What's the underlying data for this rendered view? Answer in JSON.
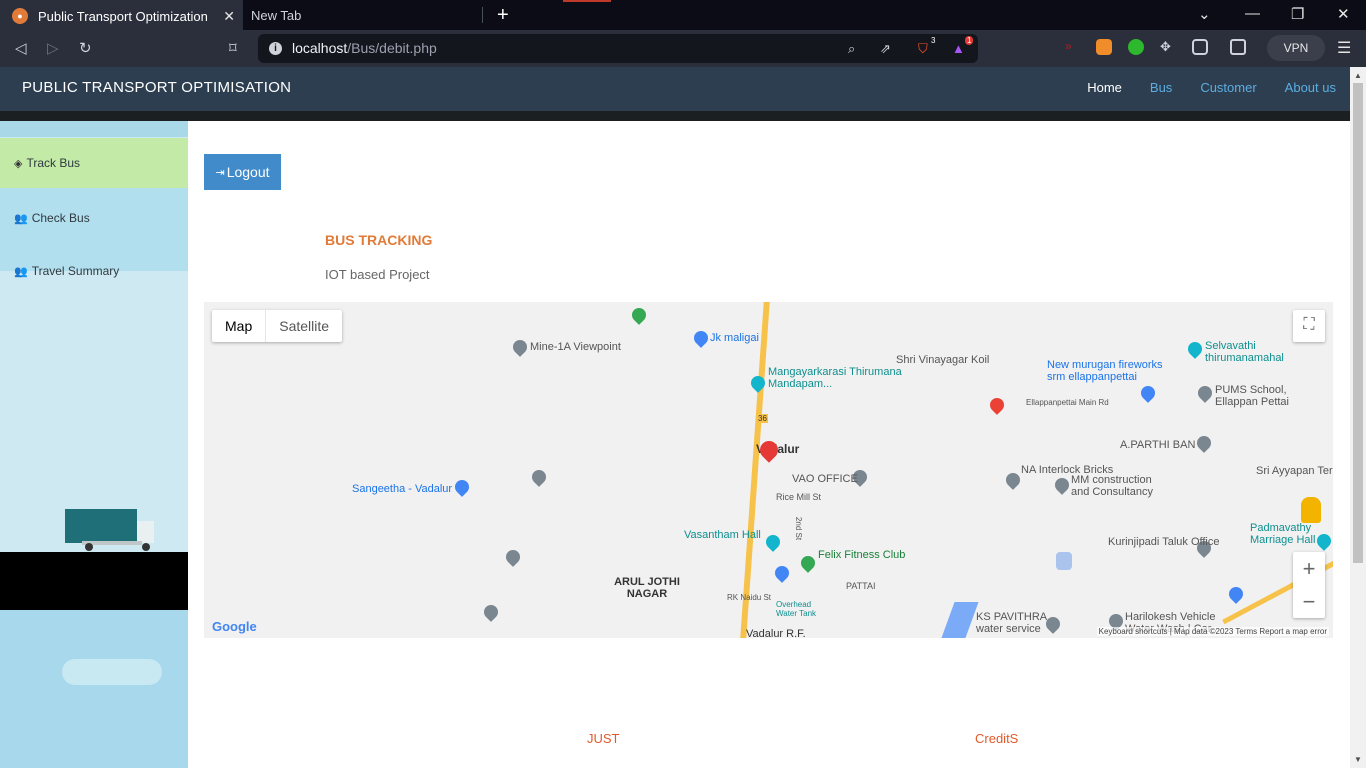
{
  "browser": {
    "tabs": [
      {
        "label": "Public Transport Optimization",
        "active": true
      },
      {
        "label": "New Tab",
        "active": false
      }
    ],
    "new_tab_icon": "+",
    "url_host": "localhost",
    "url_path": "/Bus/debit.php",
    "vpn_label": "VPN",
    "brave_badge": "3",
    "alert_badge": "1"
  },
  "site": {
    "brand": "PUBLIC TRANSPORT OPTIMISATION",
    "nav": [
      "Home",
      "Bus",
      "Customer",
      "About us"
    ]
  },
  "sidebar": {
    "items": [
      {
        "label": "Track Bus",
        "icon": "cubes-icon",
        "active": true
      },
      {
        "label": "Check Bus",
        "icon": "users-icon",
        "active": false
      },
      {
        "label": "Travel Summary",
        "icon": "users-icon",
        "active": false
      }
    ]
  },
  "main": {
    "logout_label": "Logout",
    "title": "BUS TRACKING",
    "subtitle": "IOT based Project"
  },
  "map": {
    "type_map": "Map",
    "type_satellite": "Satellite",
    "places": [
      "Mine-1A Viewpoint",
      "Jk maligai",
      "Mangayarkarasi Thirumana Mandapam...",
      "Shri Vinayagar Koil",
      "New murugan fireworks srm ellappanpettai",
      "Selvavathi thirumanamahal",
      "PUMS School, Ellappan Pettai",
      "A.PARTHI BAN",
      "Sri Ayyapan Ter",
      "Sangeetha - Vadalur",
      "Vadalur",
      "VAO OFFICE",
      "Rice Mill St",
      "NA Interlock Bricks",
      "MM construction and Consultancy",
      "Vasantham Hall",
      "Felix Fitness Club",
      "Kurinjipadi Taluk Office",
      "Padmavathy Marriage Hall",
      "ARUL JOTHI NAGAR",
      "RK Naidu St",
      "Overhead Water Tank",
      "Vadalur R.F.",
      "PATTAI",
      "KS PAVITHRA water service",
      "Harilokesh Vehicle Water Wash | Car",
      "Ellappanpettai Main Rd",
      "36",
      "2nd St"
    ],
    "google_logo": "Google",
    "attribution": "Keyboard shortcuts | Map data ©2023   Terms   Report a map error"
  },
  "footer": {
    "left": "JUST",
    "right": "CreditS"
  }
}
